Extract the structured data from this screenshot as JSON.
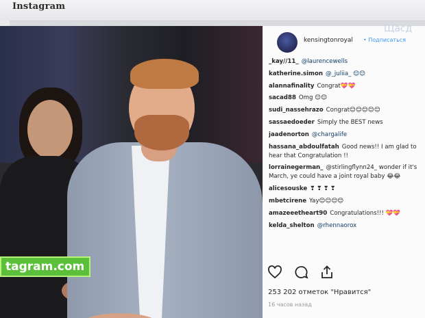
{
  "app": {
    "title": "Instagram",
    "ghost_text": "Щасд"
  },
  "post": {
    "username": "kensingtonroyal",
    "follow_label": "• Подписаться",
    "watermark": "tagram.com",
    "comments": [
      {
        "user": "_kay//11_",
        "text": "@laurencewells"
      },
      {
        "user": "katherine.simon",
        "text": "@_juliia_ 😊😊"
      },
      {
        "user": "alannafinality",
        "text": "Congrat💝💝"
      },
      {
        "user": "sacad88",
        "text": "Omg 😊😊"
      },
      {
        "user": "sudi_nassehrazo",
        "text": "Congrat😊😊😊😊😊"
      },
      {
        "user": "sassaedoeder",
        "text": "Simply the BEST news"
      },
      {
        "user": "jaadenorton",
        "text": "@chargalife"
      },
      {
        "user": "hassana_abdoulfatah",
        "text": "Good news!! I am glad to hear that Congratulation !!"
      },
      {
        "user": "lorrainegerman_",
        "text": "@stirlingflynn24_ wonder if it's March, ye could have a joint royal baby 😂😂"
      },
      {
        "user": "alicesouske",
        "text": "❣ ❣ ❣ ❣"
      },
      {
        "user": "mbetcirene",
        "text": "Yay😊😊😊😊"
      },
      {
        "user": "amazeeetheart90",
        "text": "Congratulations!!! 💝💝"
      },
      {
        "user": "kelda_shelton",
        "text": "@rhennaorox"
      }
    ],
    "likes": "253 202 отметок \"Нравится\"",
    "time_text": "16 часов назад"
  },
  "colors": {
    "accent": "#3897f0",
    "watermark": "#5bbf3a"
  }
}
